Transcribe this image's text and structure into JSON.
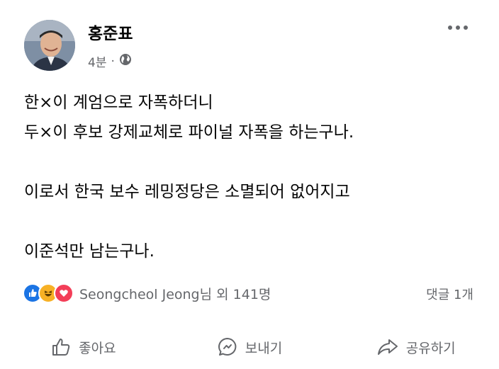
{
  "post": {
    "author": "홍준표",
    "time": "4분",
    "separator": "·",
    "privacy_icon": "globe-icon",
    "lines": [
      "한×이 계엄으로 자폭하더니",
      "두×이 후보 강제교체로 파이널 자폭을 하는구나.",
      "",
      "이로서 한국 보수 레밍정당은 소멸되어 없어지고",
      "",
      "이준석만 남는구나."
    ]
  },
  "reactions": {
    "icons": [
      "like-icon",
      "haha-icon",
      "love-icon"
    ],
    "text": "Seongcheol Jeong님 외 141명",
    "comments": "댓글 1개"
  },
  "actions": {
    "like": "좋아요",
    "send": "보내기",
    "share": "공유하기"
  },
  "colors": {
    "like": "#1b74e4",
    "haha": "#f7b125",
    "love": "#f33e58",
    "secondary_text": "#65676b"
  }
}
